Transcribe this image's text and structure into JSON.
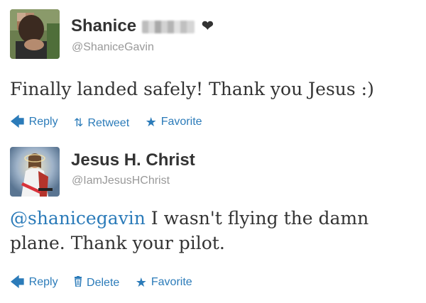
{
  "tweets": [
    {
      "author": {
        "name": "Shanice",
        "handle": "@ShaniceGavin"
      },
      "text": "Finally landed safely! Thank you Jesus :)",
      "actions": {
        "reply": "Reply",
        "retweet": "Retweet",
        "favorite": "Favorite"
      }
    },
    {
      "author": {
        "name": "Jesus H. Christ",
        "handle": "@IamJesusHChrist"
      },
      "mention": "@shanicegavin",
      "text": " I wasn't flying the damn plane. Thank your pilot.",
      "actions": {
        "reply": "Reply",
        "delete": "Delete",
        "favorite": "Favorite"
      }
    }
  ],
  "colors": {
    "link": "#2b7bb9",
    "name": "#333333",
    "handle": "#999999"
  },
  "icons": [
    "reply-icon",
    "retweet-icon",
    "favorite-icon",
    "delete-icon",
    "heart-icon"
  ]
}
